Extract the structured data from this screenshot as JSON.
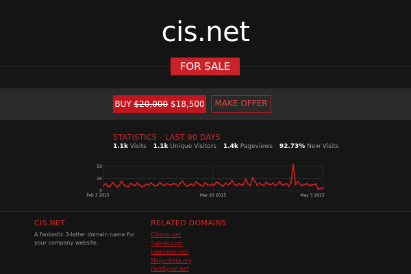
{
  "site": {
    "domain": "cis.net",
    "badge": "FOR SALE"
  },
  "actions": {
    "buy_label": "BUY",
    "old_price": "$20,000",
    "new_price": "$18,500",
    "offer_label": "MAKE OFFER"
  },
  "stats": {
    "title": "STATISTICS - LAST 90 DAYS",
    "items": [
      {
        "value": "1.1k",
        "label": "Visits"
      },
      {
        "value": "1.1k",
        "label": "Unique Visitors"
      },
      {
        "value": "1.4k",
        "label": "Pageviews"
      },
      {
        "value": "92.73%",
        "label": "New Visits"
      }
    ]
  },
  "chart_data": {
    "type": "line",
    "x_tick_labels": [
      "Feb 3 2015",
      "Mar 20 2015",
      "May 3 2015"
    ],
    "y_tick_labels": [
      "0",
      "25",
      "50"
    ],
    "ylim": [
      0,
      55
    ],
    "grid": true,
    "series": [
      {
        "color": "#cc1f1f",
        "values": [
          10,
          14,
          8,
          9,
          16,
          12,
          7,
          10,
          19,
          12,
          9,
          8,
          14,
          12,
          10,
          15,
          11,
          8,
          9,
          13,
          11,
          15,
          12,
          9,
          11,
          16,
          12,
          10,
          14,
          12,
          11,
          14,
          13,
          9,
          15,
          19,
          12,
          9,
          11,
          13,
          10,
          18,
          14,
          11,
          9,
          16,
          12,
          10,
          13,
          11,
          17,
          15,
          11,
          9,
          15,
          12,
          14,
          20,
          12,
          10,
          14,
          11,
          12,
          23,
          13,
          10,
          26,
          19,
          11,
          15,
          12,
          10,
          17,
          13,
          12,
          15,
          10,
          13,
          18,
          11,
          12,
          14,
          9,
          16,
          53,
          12,
          18,
          13,
          10,
          12,
          14,
          10,
          11,
          12,
          13,
          3,
          4,
          5
        ]
      }
    ]
  },
  "footer": {
    "about_heading": "CIS.NET",
    "about_text": "A fantastic 3-letter domain name for your company website.",
    "related_heading": "RELATED DOMAINS",
    "related": [
      "Clinton.net",
      "Sabula.com",
      "Lowmoor.com",
      "Maquoketa.org",
      "PostByron.net"
    ]
  },
  "colors": {
    "background": "#161616",
    "accent": "#c0171f",
    "band": "#2a2a2a"
  }
}
